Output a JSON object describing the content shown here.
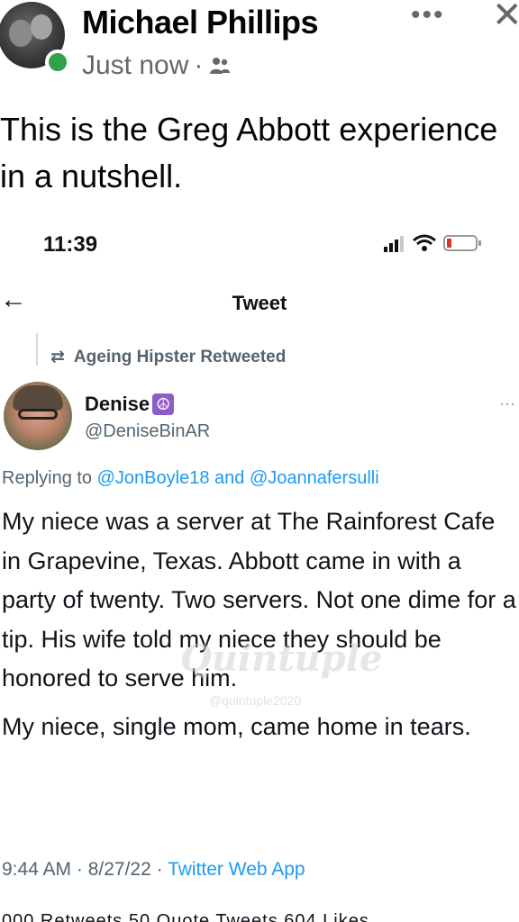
{
  "post": {
    "author": "Michael Phillips",
    "time": "Just now",
    "separator": "·",
    "text": "This is the Greg Abbott experience in a nutshell."
  },
  "icons": {
    "more": "•••",
    "close": "✕"
  },
  "screenshot": {
    "status_time": "11:39",
    "header_title": "Tweet",
    "back": "←",
    "retweeted_by": "Ageing Hipster Retweeted",
    "retweet_glyph": "⇄",
    "user_name": "Denise",
    "peace_glyph": "☮",
    "user_handle": "@DeniseBinAR",
    "more": "···",
    "replying_prefix": "Replying to",
    "mention1": "@JonBoyle18",
    "replying_and": "and",
    "mention2": "@Joannafersulli",
    "paragraph1": "My niece was a server at The Rainforest Cafe in Grapevine, Texas. Abbott came in with a party of twenty. Two servers. Not one dime for a tip. His wife told my niece they should be honored to serve him.",
    "paragraph2": "My niece, single mom, came home in tears.",
    "timestamp": "9:44 AM · 8/27/22 ·",
    "app": "Twitter Web App",
    "stats_partial": "000 Retweets   50 Quote Tweets   604 Likes"
  },
  "watermark": {
    "main": "Quintuple",
    "sub": "@quintuple2020"
  },
  "colors": {
    "facebook_online": "#31a24c",
    "twitter_blue": "#1d9bf0",
    "muted": "#536471"
  }
}
